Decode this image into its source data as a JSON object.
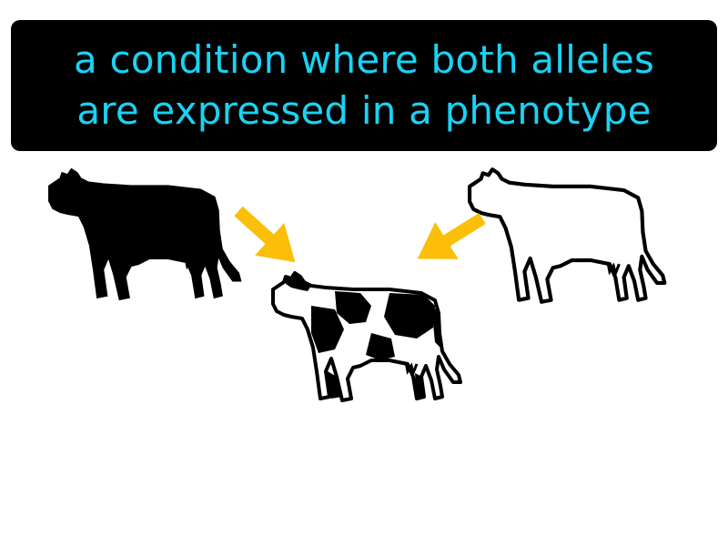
{
  "definition": {
    "line1": "a condition where both alleles",
    "line2": "are expressed in a phenotype"
  },
  "colors": {
    "banner_background": "#000000",
    "banner_text": "#19d3f3",
    "arrow": "#fbbf0a",
    "black_cow": "#000000",
    "white_cow_fill": "#ffffff",
    "outline": "#000000"
  },
  "icons": {
    "left": "black-cow-icon",
    "right": "white-cow-icon",
    "center": "spotted-cow-icon",
    "arrows": "arrow-icon"
  }
}
